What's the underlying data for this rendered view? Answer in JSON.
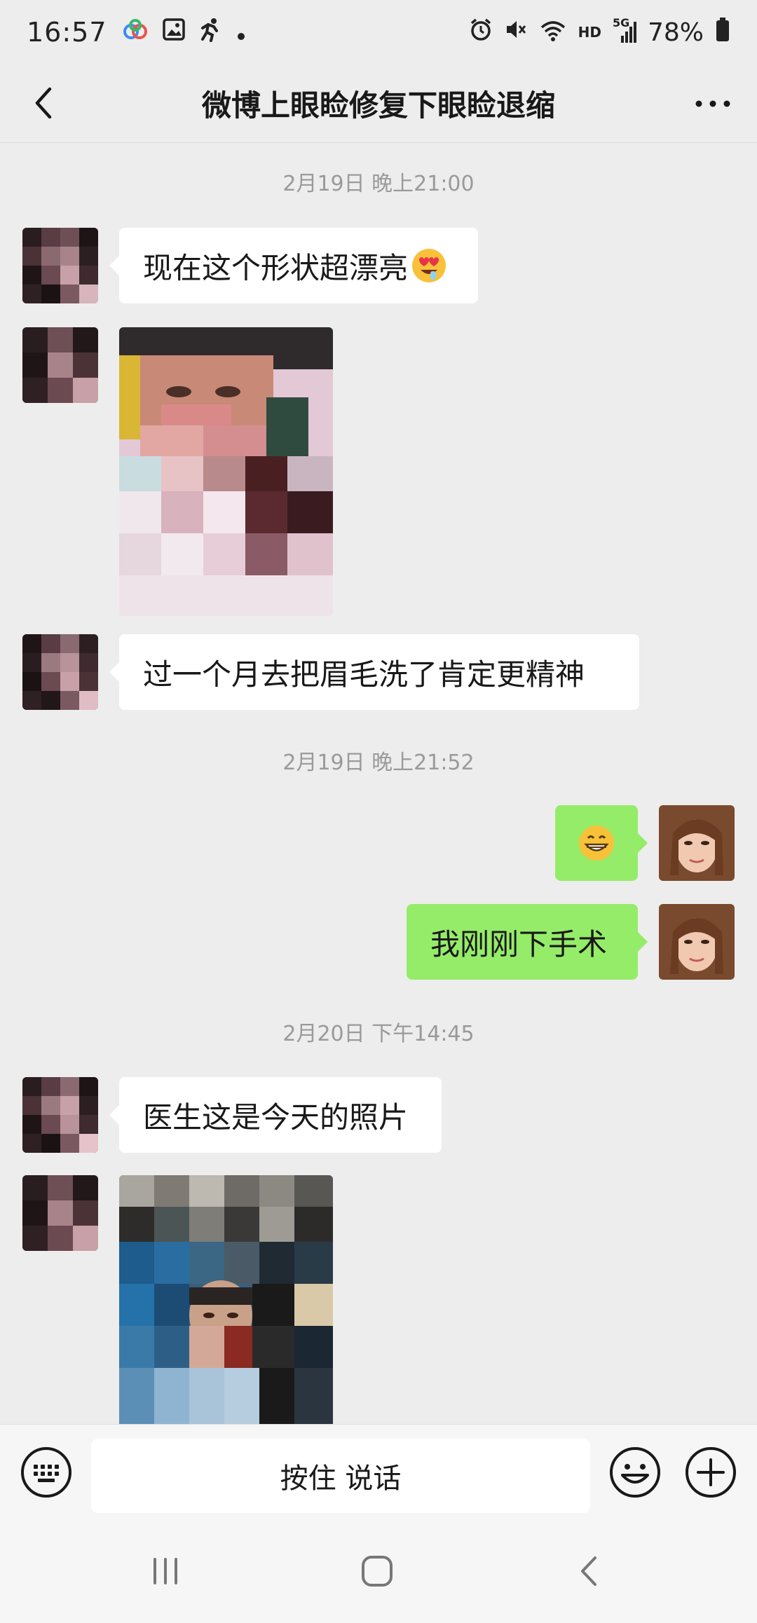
{
  "status_bar": {
    "time": "16:57",
    "network_label": "HD",
    "signal_label": "5G",
    "battery": "78%",
    "left_icons": [
      "cloud-icon",
      "gallery-icon",
      "running-man-icon",
      "dot-icon"
    ],
    "right_icons": [
      "alarm-icon",
      "mute-icon",
      "wifi-icon",
      "signal-icon",
      "battery-icon"
    ]
  },
  "header": {
    "title": "微博上眼睑修复下眼睑退缩",
    "back_icon": "chevron-left-icon",
    "more_icon": "more-dots-icon"
  },
  "messages": [
    {
      "type": "timestamp",
      "text": "2月19日 晚上21:00"
    },
    {
      "type": "text",
      "side": "left",
      "text": "现在这个形状超漂亮",
      "emoji": "heart-eyes-emoji"
    },
    {
      "type": "image",
      "side": "left",
      "description": "pixelated-photo"
    },
    {
      "type": "text",
      "side": "left",
      "text": "过一个月去把眉毛洗了肯定更精神"
    },
    {
      "type": "timestamp",
      "text": "2月19日 晚上21:52"
    },
    {
      "type": "emoji",
      "side": "right",
      "emoji": "grinning-emoji"
    },
    {
      "type": "text",
      "side": "right",
      "text": "我刚刚下手术"
    },
    {
      "type": "timestamp",
      "text": "2月20日 下午14:45"
    },
    {
      "type": "text",
      "side": "left",
      "text": "医生这是今天的照片"
    },
    {
      "type": "image",
      "side": "left",
      "description": "pixelated-photo"
    }
  ],
  "input_bar": {
    "voice_label": "按住 说话",
    "keyboard_icon": "keyboard-icon",
    "emoji_icon": "smiley-icon",
    "plus_icon": "plus-circle-icon"
  },
  "nav_bar": {
    "icons": [
      "recents-icon",
      "home-icon",
      "back-nav-icon"
    ]
  },
  "colors": {
    "background": "#ededed",
    "bubble_self": "#95ec69",
    "bubble_other": "#ffffff",
    "timestamp_text": "#9a9a9a"
  }
}
